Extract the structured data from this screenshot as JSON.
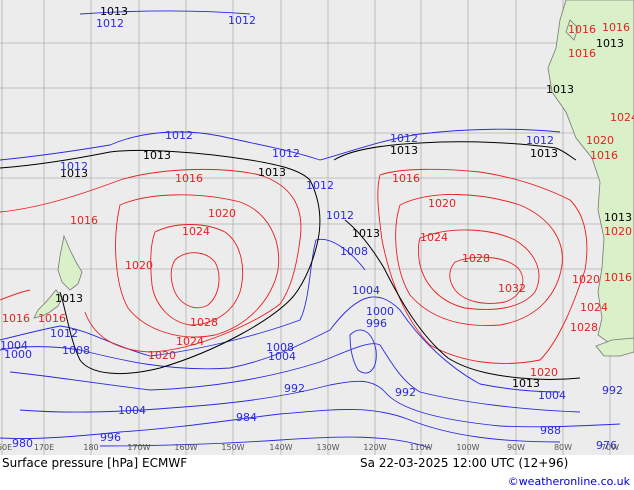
{
  "map": {
    "colors": {
      "ocean": "#ececec",
      "land": "#d9f0c8",
      "coast": "#777777",
      "grid": "#b0b0b0",
      "low": "#2a2ae0",
      "high": "#e82020",
      "ref": "#000000"
    },
    "longitude_labels": [
      "160E",
      "170E",
      "180",
      "170W",
      "160W",
      "150W",
      "140W",
      "130W",
      "120W",
      "110W",
      "100W",
      "90W",
      "80W",
      "70W"
    ],
    "isobar_labels": {
      "black": [
        "1013",
        "1013",
        "1013",
        "1013",
        "1013",
        "1013",
        "1013",
        "1013",
        "1013",
        "1013",
        "1013",
        "1013"
      ],
      "blue": [
        "1012",
        "1012",
        "1012",
        "1012",
        "1012",
        "1012",
        "1012",
        "1012",
        "1012",
        "1012",
        "1008",
        "1008",
        "1008",
        "1004",
        "1004",
        "1004",
        "1004",
        "1000",
        "1000",
        "996",
        "996",
        "992",
        "992",
        "992",
        "988",
        "984",
        "980",
        "976",
        "1004"
      ],
      "red": [
        "1016",
        "1016",
        "1016",
        "1016",
        "1016",
        "1016",
        "1016",
        "1020",
        "1020",
        "1020",
        "1020",
        "1020",
        "1020",
        "1024",
        "1024",
        "1024",
        "1024",
        "1028",
        "1028",
        "1028",
        "1032",
        "1020",
        "1016",
        "1016",
        "1016",
        "1020",
        "1024"
      ]
    }
  },
  "footer": {
    "title": "Surface pressure [hPa] ECMWF",
    "datetime": "Sa 22-03-2025 12:00 UTC (12+96)",
    "credit": "©weatheronline.co.uk"
  }
}
